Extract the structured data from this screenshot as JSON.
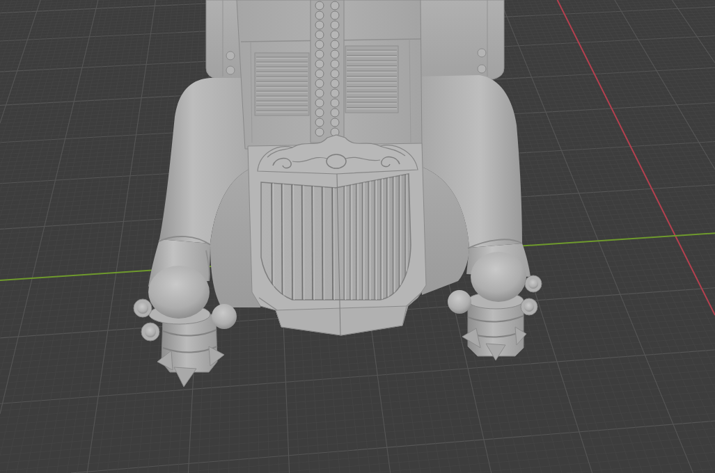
{
  "viewport": {
    "axes": [
      {
        "kind": "x",
        "color": "#b4404f"
      },
      {
        "kind": "y",
        "color": "#6f9a2d"
      }
    ]
  }
}
